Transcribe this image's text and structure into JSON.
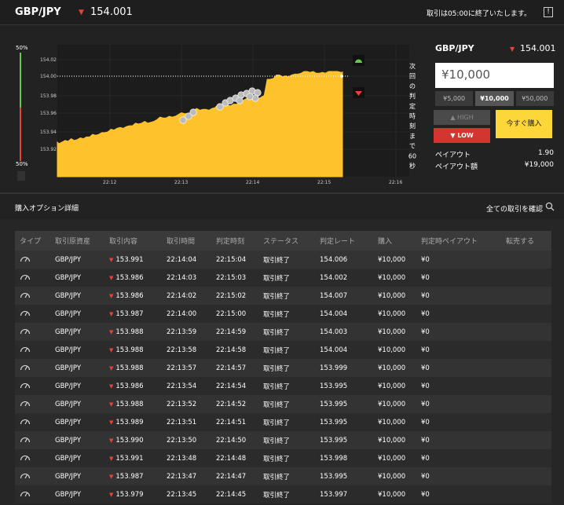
{
  "header": {
    "pair": "GBP/JPY",
    "price": "154.001",
    "notice": "取引は05:00に終了いたします。",
    "help_icon": "info-icon"
  },
  "chart": {
    "y_ticks": [
      "154.02",
      "154.00",
      "153.98",
      "153.96",
      "153.94",
      "153.92"
    ],
    "x_ticks": [
      "22:12",
      "22:13",
      "22:14",
      "22:15",
      "22:16"
    ],
    "left_top_pct": "50%",
    "left_bottom_pct": "50%",
    "countdown": [
      "次",
      "回",
      "の",
      "判",
      "定",
      "時",
      "刻",
      "ま",
      "で",
      "60",
      "秒"
    ],
    "colors": {
      "fill": "#fdc22c",
      "up": "#65c94a",
      "down": "#e8433b"
    }
  },
  "trade_panel": {
    "pair": "GBP/JPY",
    "price": "154.001",
    "amount": "¥10,000",
    "presets": [
      "¥5,000",
      "¥10,000",
      "¥50,000"
    ],
    "selected_preset": "¥10,000",
    "high_label": "HIGH",
    "low_label": "LOW",
    "buy_label": "今すぐ購入",
    "payout_label": "ペイアウト",
    "payout_value": "1.90",
    "payout_amount_label": "ペイアウト額",
    "payout_amount_value": "¥19,000"
  },
  "details": {
    "title": "購入オプション詳細",
    "view_all": "全ての取引を確認"
  },
  "table": {
    "columns": [
      "タイプ",
      "取引原資産",
      "取引内容",
      "取引時間",
      "判定時刻",
      "ステータス",
      "判定レート",
      "購入",
      "判定時ペイアウト",
      "転売する"
    ],
    "rows": [
      {
        "asset": "GBP/JPY",
        "rate": "153.991",
        "time": "22:14:04",
        "judge": "22:15:04",
        "status": "取引終了",
        "judge_rate": "154.006",
        "buy": "¥10,000",
        "payout": "¥0"
      },
      {
        "asset": "GBP/JPY",
        "rate": "153.986",
        "time": "22:14:03",
        "judge": "22:15:03",
        "status": "取引終了",
        "judge_rate": "154.002",
        "buy": "¥10,000",
        "payout": "¥0"
      },
      {
        "asset": "GBP/JPY",
        "rate": "153.986",
        "time": "22:14:02",
        "judge": "22:15:02",
        "status": "取引終了",
        "judge_rate": "154.007",
        "buy": "¥10,000",
        "payout": "¥0"
      },
      {
        "asset": "GBP/JPY",
        "rate": "153.987",
        "time": "22:14:00",
        "judge": "22:15:00",
        "status": "取引終了",
        "judge_rate": "154.004",
        "buy": "¥10,000",
        "payout": "¥0"
      },
      {
        "asset": "GBP/JPY",
        "rate": "153.988",
        "time": "22:13:59",
        "judge": "22:14:59",
        "status": "取引終了",
        "judge_rate": "154.003",
        "buy": "¥10,000",
        "payout": "¥0"
      },
      {
        "asset": "GBP/JPY",
        "rate": "153.988",
        "time": "22:13:58",
        "judge": "22:14:58",
        "status": "取引終了",
        "judge_rate": "154.004",
        "buy": "¥10,000",
        "payout": "¥0"
      },
      {
        "asset": "GBP/JPY",
        "rate": "153.988",
        "time": "22:13:57",
        "judge": "22:14:57",
        "status": "取引終了",
        "judge_rate": "153.999",
        "buy": "¥10,000",
        "payout": "¥0"
      },
      {
        "asset": "GBP/JPY",
        "rate": "153.986",
        "time": "22:13:54",
        "judge": "22:14:54",
        "status": "取引終了",
        "judge_rate": "153.995",
        "buy": "¥10,000",
        "payout": "¥0"
      },
      {
        "asset": "GBP/JPY",
        "rate": "153.988",
        "time": "22:13:52",
        "judge": "22:14:52",
        "status": "取引終了",
        "judge_rate": "153.995",
        "buy": "¥10,000",
        "payout": "¥0"
      },
      {
        "asset": "GBP/JPY",
        "rate": "153.989",
        "time": "22:13:51",
        "judge": "22:14:51",
        "status": "取引終了",
        "judge_rate": "153.995",
        "buy": "¥10,000",
        "payout": "¥0"
      },
      {
        "asset": "GBP/JPY",
        "rate": "153.990",
        "time": "22:13:50",
        "judge": "22:14:50",
        "status": "取引終了",
        "judge_rate": "153.995",
        "buy": "¥10,000",
        "payout": "¥0"
      },
      {
        "asset": "GBP/JPY",
        "rate": "153.991",
        "time": "22:13:48",
        "judge": "22:14:48",
        "status": "取引終了",
        "judge_rate": "153.998",
        "buy": "¥10,000",
        "payout": "¥0"
      },
      {
        "asset": "GBP/JPY",
        "rate": "153.987",
        "time": "22:13:47",
        "judge": "22:14:47",
        "status": "取引終了",
        "judge_rate": "153.995",
        "buy": "¥10,000",
        "payout": "¥0"
      },
      {
        "asset": "GBP/JPY",
        "rate": "153.979",
        "time": "22:13:45",
        "judge": "22:14:45",
        "status": "取引終了",
        "judge_rate": "153.997",
        "buy": "¥10,000",
        "payout": "¥0"
      }
    ]
  }
}
